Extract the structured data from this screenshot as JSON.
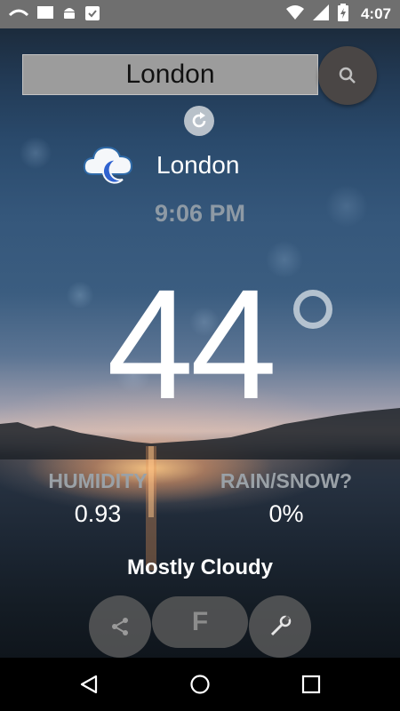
{
  "status_bar": {
    "time": "4:07",
    "icons": [
      "cast-icon",
      "square-icon",
      "android-icon",
      "clipboard-check-icon",
      "wifi-icon",
      "signal-icon",
      "battery-charging-icon"
    ]
  },
  "search": {
    "value": "London",
    "button_icon": "search-icon",
    "refresh_icon": "refresh-icon"
  },
  "weather": {
    "icon": "cloudy-night-icon",
    "city": "London",
    "time": "9:06 PM",
    "temperature": "44",
    "degree_icon": "degree-icon",
    "humidity_label": "HUMIDITY",
    "humidity_value": "0.93",
    "precip_label": "RAIN/SNOW?",
    "precip_value": "0%",
    "condition": "Mostly Cloudy"
  },
  "actions": {
    "share_icon": "share-icon",
    "unit_label": "F",
    "settings_icon": "wrench-icon"
  },
  "nav": {
    "icons": [
      "back-icon",
      "home-icon",
      "recents-icon"
    ]
  }
}
